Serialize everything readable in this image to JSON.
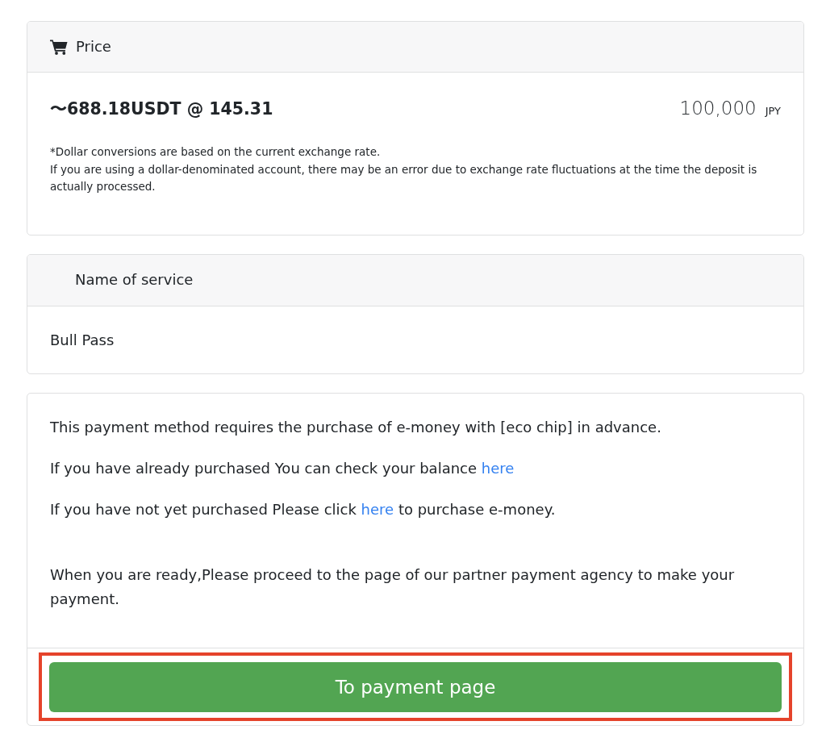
{
  "price_card": {
    "header": "Price",
    "usdt_price": "〜688.18USDT @ 145.31",
    "amount": "100,000",
    "currency": "JPY",
    "note_lines": [
      "*Dollar conversions are based on the current exchange rate.",
      "If you are using a dollar-denominated account, there may be an error due to exchange rate fluctuations at the time the deposit is actually processed."
    ]
  },
  "service_card": {
    "header": "Name of service",
    "value": "Bull Pass"
  },
  "payment_card": {
    "paragraphs": [
      {
        "parts": [
          {
            "kind": "text",
            "text": "This payment method requires the purchase of e-money with [eco chip] in advance."
          }
        ]
      },
      {
        "parts": [
          {
            "kind": "text",
            "text": "If you have already purchased You can check your balance "
          },
          {
            "kind": "link",
            "text": "here"
          }
        ]
      },
      {
        "parts": [
          {
            "kind": "text",
            "text": "If you have not yet purchased Please click "
          },
          {
            "kind": "link",
            "text": "here"
          },
          {
            "kind": "text",
            "text": " to purchase e-money."
          }
        ]
      },
      {
        "parts": [
          {
            "kind": "text",
            "text": "When you are ready,Please proceed to the page of our partner payment agency to make your payment."
          }
        ]
      }
    ],
    "button": {
      "label": "To payment page",
      "highlighted": true
    }
  }
}
